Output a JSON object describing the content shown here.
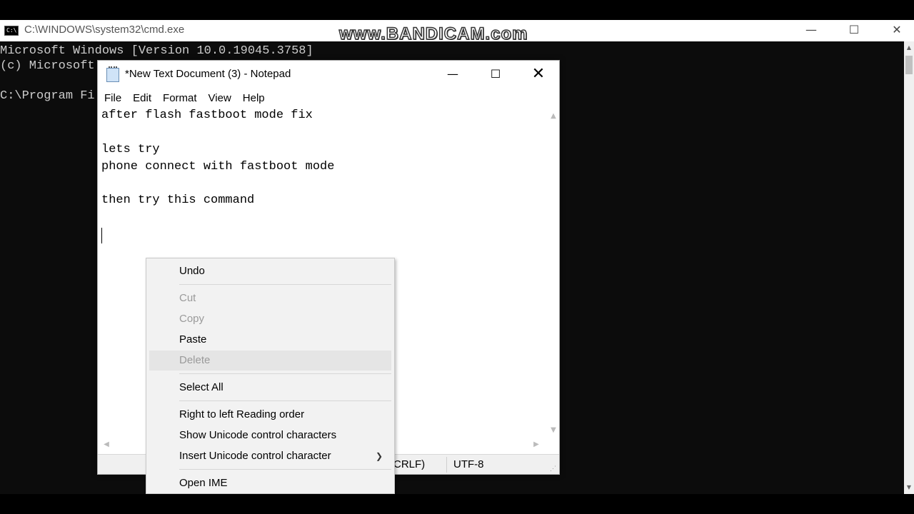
{
  "cmd": {
    "title": "C:\\WINDOWS\\system32\\cmd.exe",
    "icon_text": "C:\\",
    "watermark": "www.BANDICAM.com",
    "controls": {
      "minimize": "—",
      "maximize": "☐",
      "close": "✕"
    },
    "lines": [
      "Microsoft Windows [Version 10.0.19045.3758]",
      "(c) Microsoft",
      "C:\\Program Fi"
    ]
  },
  "notepad": {
    "title": "*New Text Document (3) - Notepad",
    "controls": {
      "minimize": "—",
      "maximize": "☐",
      "close": "✕"
    },
    "menu": [
      "File",
      "Edit",
      "Format",
      "View",
      "Help"
    ],
    "content_lines": [
      "after flash fastboot mode fix",
      "",
      "lets try",
      "phone connect with fastboot mode",
      "",
      "then try this command"
    ],
    "status": {
      "line_ending": "CRLF)",
      "encoding": "UTF-8"
    }
  },
  "context_menu": {
    "items": [
      {
        "label": "Undo",
        "enabled": true
      },
      {
        "label": "Cut",
        "enabled": false
      },
      {
        "label": "Copy",
        "enabled": false
      },
      {
        "label": "Paste",
        "enabled": true
      },
      {
        "label": "Delete",
        "enabled": false,
        "hovered": true
      },
      {
        "label": "Select All",
        "enabled": true
      },
      {
        "label": "Right to left Reading order",
        "enabled": true
      },
      {
        "label": "Show Unicode control characters",
        "enabled": true
      },
      {
        "label": "Insert Unicode control character",
        "enabled": true,
        "submenu_icon": "chevron-right-icon"
      },
      {
        "label": "Open IME",
        "enabled": true
      }
    ]
  }
}
